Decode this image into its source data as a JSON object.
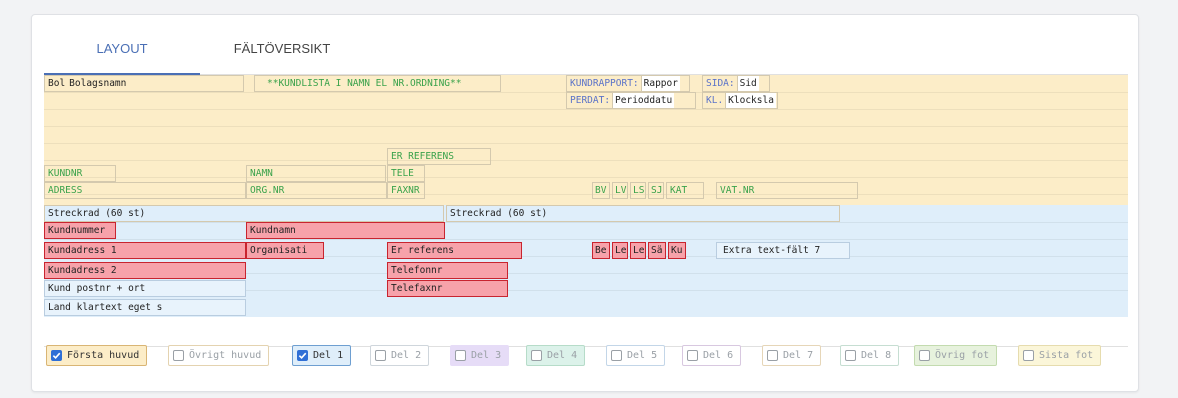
{
  "tabs": [
    {
      "label": "LAYOUT",
      "active": true
    },
    {
      "label": "FÄLTÖVERSIKT",
      "active": false
    }
  ],
  "header_fields": {
    "bol": "Bol",
    "bolagsnamn": "Bolagsnamn",
    "kundlista": "**KUNDLISTA I NAMN EL NR.ORDNING**",
    "kundrapport_label": "KUNDRAPPORT:",
    "kundrapport_value": "Rappor",
    "sida_label": "SIDA:",
    "sida_value": "Sid",
    "perdat_label": "PERDAT:",
    "perdat_value": "Perioddatu",
    "kl_label": "KL.",
    "kl_value": "Klocksla",
    "er_referens": "ER REFERENS",
    "kundnr": "KUNDNR",
    "namn": "NAMN",
    "tele": "TELE",
    "adress": "ADRESS",
    "org_nr": "ORG.NR",
    "faxnr": "FAXNR",
    "bv": "BV",
    "lv": "LV",
    "ls": "LS",
    "sj": "SJ",
    "kat": "KAT",
    "vat_nr": "VAT.NR",
    "streckrad_1": "Streckrad (60 st)",
    "streckrad_2": "Streckrad (60 st)"
  },
  "detail_fields": {
    "kundnummer": "Kundnummer",
    "kundnamn": "Kundnamn",
    "kundadress_1": "Kundadress 1",
    "organisati": "Organisati",
    "er_referens": "Er referens",
    "be": "Be",
    "le1": "Le",
    "le2": "Le",
    "sa": "Sä",
    "ku": "Ku",
    "extra_text": "Extra text-fält 7",
    "kundadress_2": "Kundadress 2",
    "telefonnr": "Telefonnr",
    "kund_postnr": "Kund postnr + ort",
    "telefaxnr": "Telefaxnr",
    "land_klartext": "Land klartext eget s"
  },
  "sections": [
    {
      "label": "Första huvud",
      "checked": true,
      "bg": "#fcedc8",
      "border": "#d9b574"
    },
    {
      "label": "Övrigt huvud",
      "checked": false,
      "bg": "#ffffff",
      "border": "#e4d3b0"
    },
    {
      "label": "Del 1",
      "checked": true,
      "bg": "#dfeefa",
      "border": "#6e9fd1"
    },
    {
      "label": "Del 2",
      "checked": false,
      "bg": "#ffffff",
      "border": "#cfd6dc"
    },
    {
      "label": "Del 3",
      "checked": false,
      "bg": "#e6dcf7",
      "border": "#e6dcf7"
    },
    {
      "label": "Del 4",
      "checked": false,
      "bg": "#dcf2ea",
      "border": "#b6dcc9"
    },
    {
      "label": "Del 5",
      "checked": false,
      "bg": "#ffffff",
      "border": "#c3d6e8"
    },
    {
      "label": "Del 6",
      "checked": false,
      "bg": "#ffffff",
      "border": "#d8c8e0"
    },
    {
      "label": "Del 7",
      "checked": false,
      "bg": "#ffffff",
      "border": "#e6d6b8"
    },
    {
      "label": "Del 8",
      "checked": false,
      "bg": "#ffffff",
      "border": "#c6ded2"
    },
    {
      "label": "Övrig fot",
      "checked": false,
      "bg": "#e7f2dd",
      "border": "#c3dbaf"
    },
    {
      "label": "Sista fot",
      "checked": false,
      "bg": "#fbf6d9",
      "border": "#e6dcae"
    }
  ]
}
